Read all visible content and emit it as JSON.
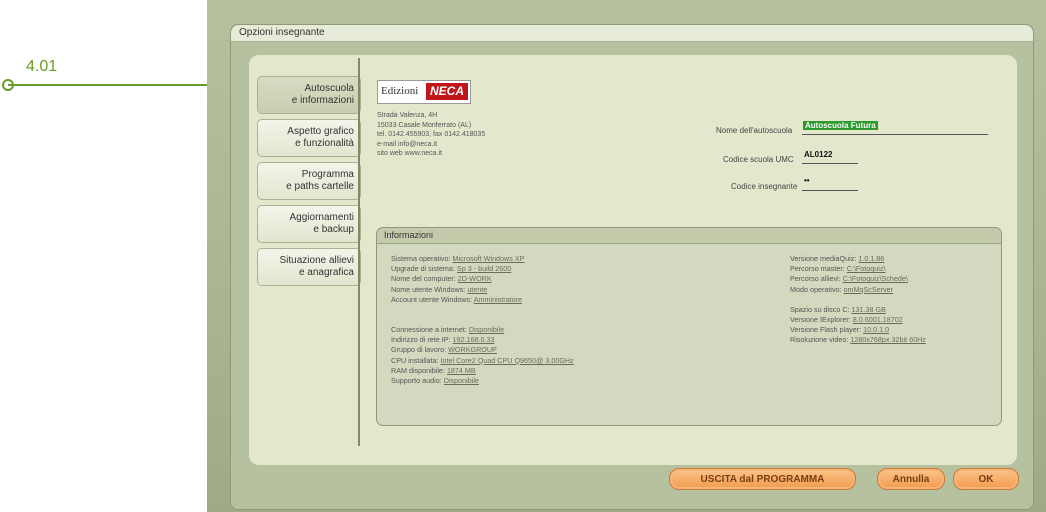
{
  "callout": {
    "label": "4.01"
  },
  "window": {
    "title": "Opzioni insegnante"
  },
  "nav": {
    "items": [
      {
        "line1": "Autoscuola",
        "line2": "e informazioni"
      },
      {
        "line1": "Aspetto grafico",
        "line2": "e funzionalità"
      },
      {
        "line1": "Programma",
        "line2": "e paths cartelle"
      },
      {
        "line1": "Aggiornamenti",
        "line2": "e backup"
      },
      {
        "line1": "Situazione allievi",
        "line2": "e anagrafica"
      }
    ]
  },
  "logo": {
    "left": "Edizioni",
    "right": "NECA"
  },
  "address": [
    "Strada Valenza, 4H",
    "15033 Casale Monferrato (AL)",
    "tel. 0142.455903, fax 0142.418035",
    "e-mail info@neca.it",
    "sito web www.neca.it"
  ],
  "fields": {
    "school_name_label": "Nome dell'autoscuola",
    "school_name_value": "Autoscuola Futura",
    "umc_label": "Codice scuola UMC",
    "umc_value": "AL0122",
    "teacher_code_label": "Codice insegnante",
    "teacher_code_value": "••"
  },
  "info": {
    "title": "Informazioni",
    "left": [
      {
        "k": "Sistema operativo:",
        "v": "Microsoft Windows XP"
      },
      {
        "k": "Upgrade di sistema:",
        "v": "Sp 3 - build 2600"
      },
      {
        "k": "Nome del computer:",
        "v": "2D-WORK"
      },
      {
        "k": "Nome utente Windows:",
        "v": "utente"
      },
      {
        "k": "Account utente Windows:",
        "v": "Amministratore"
      }
    ],
    "left2": [
      {
        "k": "Connessione a internet:",
        "v": "Disponibile"
      },
      {
        "k": "Indirizzo di rete IP:",
        "v": "192.168.0.33"
      },
      {
        "k": "Gruppo di lavoro:",
        "v": "WORKGROUP"
      },
      {
        "k": "CPU installata:",
        "v": "Intel Core2 Quad CPU Q9650@ 3.00GHz"
      },
      {
        "k": "RAM disponibile:",
        "v": "1874 MB"
      },
      {
        "k": "Supporto audio:",
        "v": "Disponibile"
      }
    ],
    "right": [
      {
        "k": "Versione mediaQuiz:",
        "v": "1.0.1.86"
      },
      {
        "k": "Percorso master:",
        "v": "C:\\Fotoquiz\\"
      },
      {
        "k": "Percorso allievi:",
        "v": "C:\\Fotoquiz\\Schede\\"
      },
      {
        "k": "Modo operativo:",
        "v": "omMqScServer"
      }
    ],
    "right2": [
      {
        "k": "Spazio su disco C:",
        "v": "131.38 GB"
      },
      {
        "k": "Versione IExplorer:",
        "v": "8.0.6001.18702"
      },
      {
        "k": "Versione Flash player:",
        "v": "10.0.1.0"
      },
      {
        "k": "Risoluzione video:",
        "v": "1280x768px 32bit 60Hz"
      }
    ]
  },
  "buttons": {
    "exit": "USCITA dal PROGRAMMA",
    "cancel": "Annulla",
    "ok": "OK"
  }
}
